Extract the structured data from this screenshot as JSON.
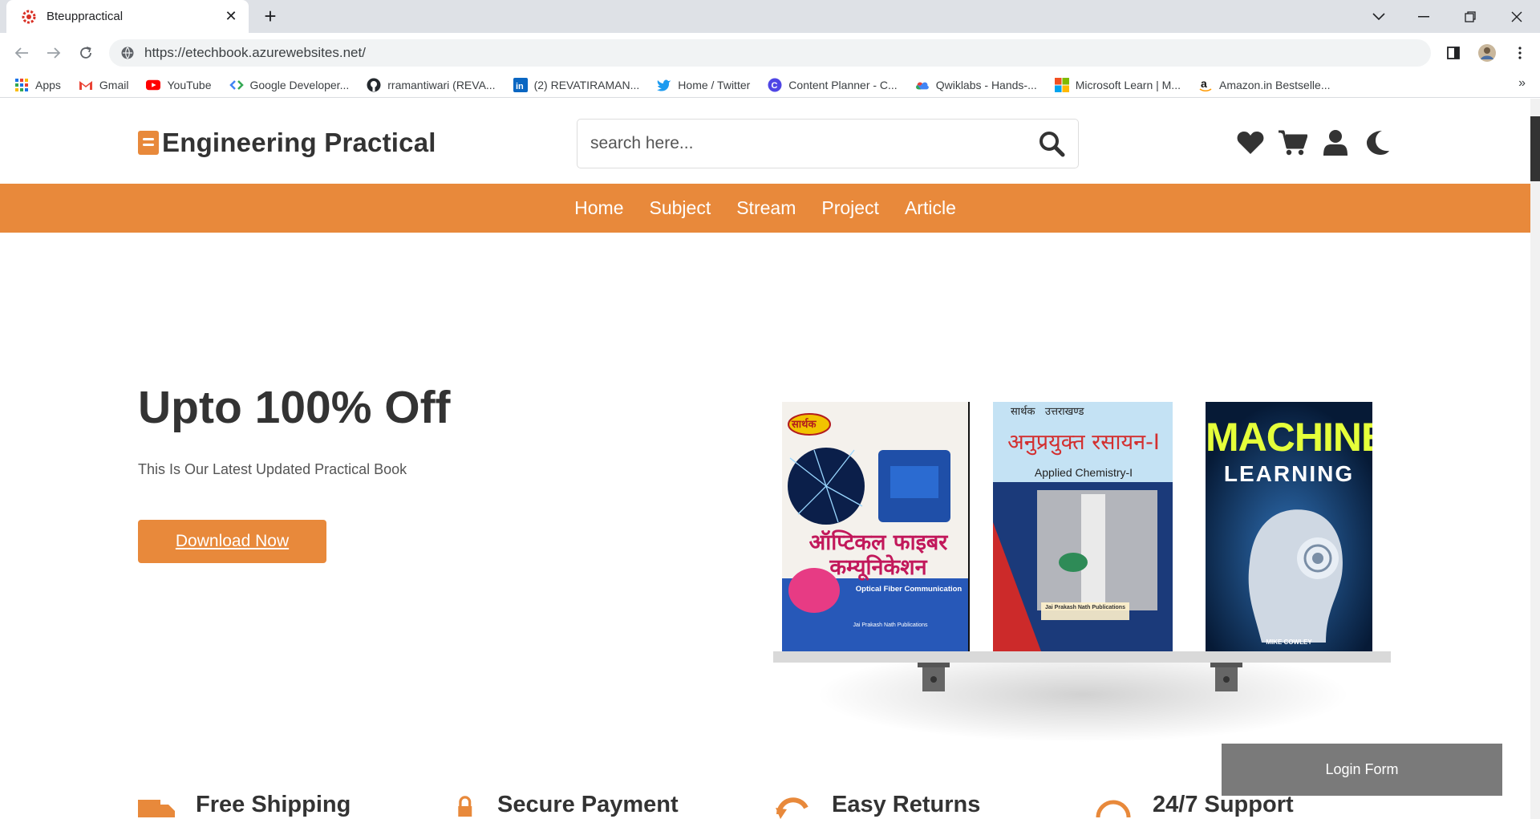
{
  "browser": {
    "tab_title": "Bteuppractical",
    "new_tab": "+",
    "url": "https://etechbook.azurewebsites.net/",
    "bookmarks": [
      {
        "label": "Apps",
        "icon": "apps-grid-icon"
      },
      {
        "label": "Gmail",
        "icon": "gmail-icon"
      },
      {
        "label": "YouTube",
        "icon": "youtube-icon"
      },
      {
        "label": "Google Developer...",
        "icon": "google-developers-icon"
      },
      {
        "label": "rramantiwari (REVA...",
        "icon": "github-icon"
      },
      {
        "label": "(2) REVATIRAMAN...",
        "icon": "linkedin-icon"
      },
      {
        "label": "Home / Twitter",
        "icon": "twitter-icon"
      },
      {
        "label": "Content Planner - C...",
        "icon": "content-planner-icon"
      },
      {
        "label": "Qwiklabs - Hands-...",
        "icon": "qwiklabs-icon"
      },
      {
        "label": "Microsoft Learn | M...",
        "icon": "microsoft-icon"
      },
      {
        "label": "Amazon.in Bestselle...",
        "icon": "amazon-icon"
      }
    ],
    "more_bookmarks": "»"
  },
  "header": {
    "logo_text": "Engineering Practical",
    "search_placeholder": "search here..."
  },
  "nav": {
    "links": [
      "Home",
      "Subject",
      "Stream",
      "Project",
      "Article"
    ]
  },
  "banner": {
    "title": "Upto 100% Off",
    "subtitle": "This Is Our Latest Updated Practical Book",
    "button": "Download Now",
    "books": [
      {
        "top_label": "सार्थक",
        "title": "ऑप्टिकल फाइबर कम्यूनिकेशन",
        "subtitle": "Optical Fiber Communication",
        "publisher": "Jai Prakash Nath Publications"
      },
      {
        "top_label": "सार्थक   उत्तराखण्ड",
        "title": "अनुप्रयुक्त रसायन-I",
        "subtitle": "Applied Chemistry-I",
        "publisher": "Jai Prakash Nath Publications"
      },
      {
        "top_label": "",
        "title": "MACHINE",
        "subtitle": "LEARNING",
        "publisher": "MIKE COWLEY"
      }
    ]
  },
  "login": {
    "button": "Login Form"
  },
  "features": [
    {
      "title": "Free Shipping",
      "icon": "truck-icon"
    },
    {
      "title": "Secure Payment",
      "icon": "lock-icon"
    },
    {
      "title": "Easy Returns",
      "icon": "returns-icon"
    },
    {
      "title": "24/7 Support",
      "icon": "headset-icon"
    }
  ],
  "colors": {
    "accent": "#e8893b",
    "text_dark": "#333333",
    "login_bg": "#7a7a7a"
  }
}
